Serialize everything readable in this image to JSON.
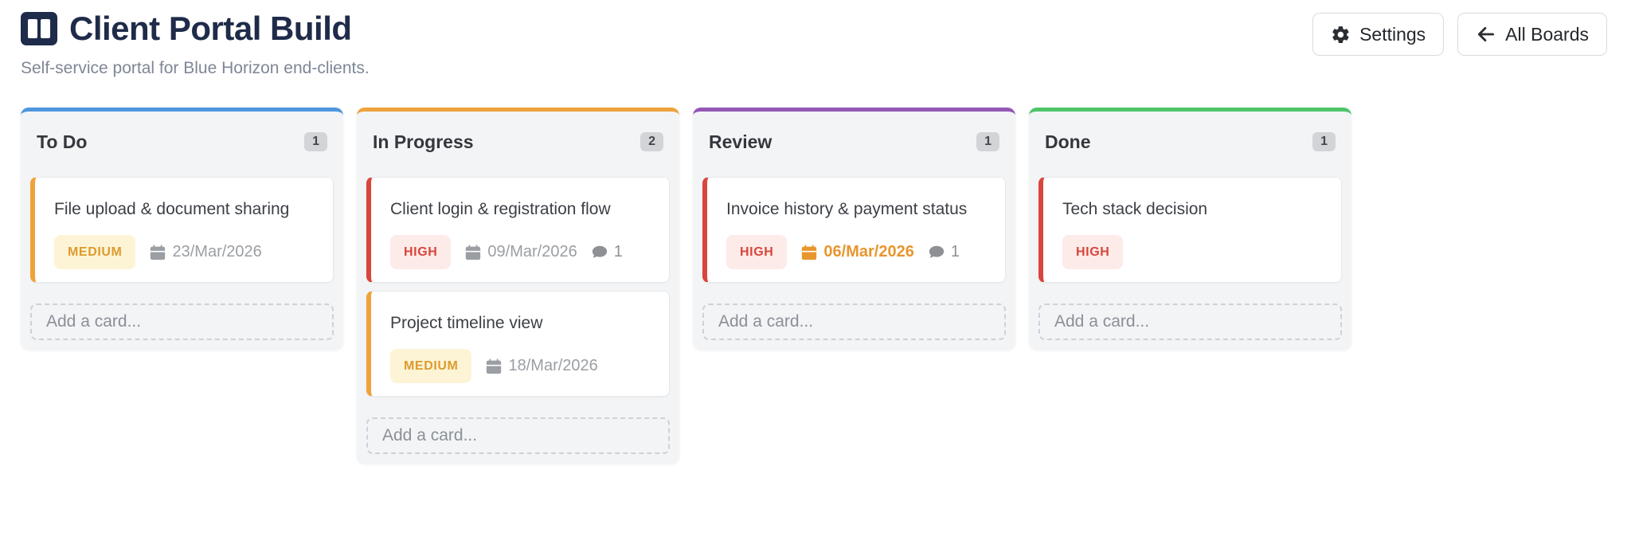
{
  "header": {
    "title": "Client Portal Build",
    "subtitle": "Self-service portal for Blue Horizon end-clients.",
    "buttons": {
      "settings": "Settings",
      "all_boards": "All Boards"
    }
  },
  "board": {
    "add_card_label": "Add a card...",
    "columns": [
      {
        "name": "To Do",
        "count": "1",
        "accent": "#4e97dd",
        "cards": [
          {
            "title": "File upload & document sharing",
            "accent": "#efa23b",
            "priority": {
              "label": "MEDIUM",
              "bg": "#fdf4d6",
              "color": "#dd9b2d"
            },
            "due": "23/Mar/2026",
            "overdue": false,
            "comments": null
          }
        ]
      },
      {
        "name": "In Progress",
        "count": "2",
        "accent": "#efa23b",
        "cards": [
          {
            "title": "Client login & registration flow",
            "accent": "#d9453c",
            "priority": {
              "label": "HIGH",
              "bg": "#fcebe8",
              "color": "#d9453c"
            },
            "due": "09/Mar/2026",
            "overdue": false,
            "comments": "1"
          },
          {
            "title": "Project timeline view",
            "accent": "#efa23b",
            "priority": {
              "label": "MEDIUM",
              "bg": "#fdf4d6",
              "color": "#dd9b2d"
            },
            "due": "18/Mar/2026",
            "overdue": false,
            "comments": null
          }
        ]
      },
      {
        "name": "Review",
        "count": "1",
        "accent": "#9457b5",
        "cards": [
          {
            "title": "Invoice history & payment status",
            "accent": "#d9453c",
            "priority": {
              "label": "HIGH",
              "bg": "#fcebe8",
              "color": "#d9453c"
            },
            "due": "06/Mar/2026",
            "overdue": true,
            "comments": "1"
          }
        ]
      },
      {
        "name": "Done",
        "count": "1",
        "accent": "#4ec469",
        "cards": [
          {
            "title": "Tech stack decision",
            "accent": "#d9453c",
            "priority": {
              "label": "HIGH",
              "bg": "#fcebe8",
              "color": "#d9453c"
            },
            "due": null,
            "overdue": false,
            "comments": null
          }
        ]
      }
    ]
  }
}
